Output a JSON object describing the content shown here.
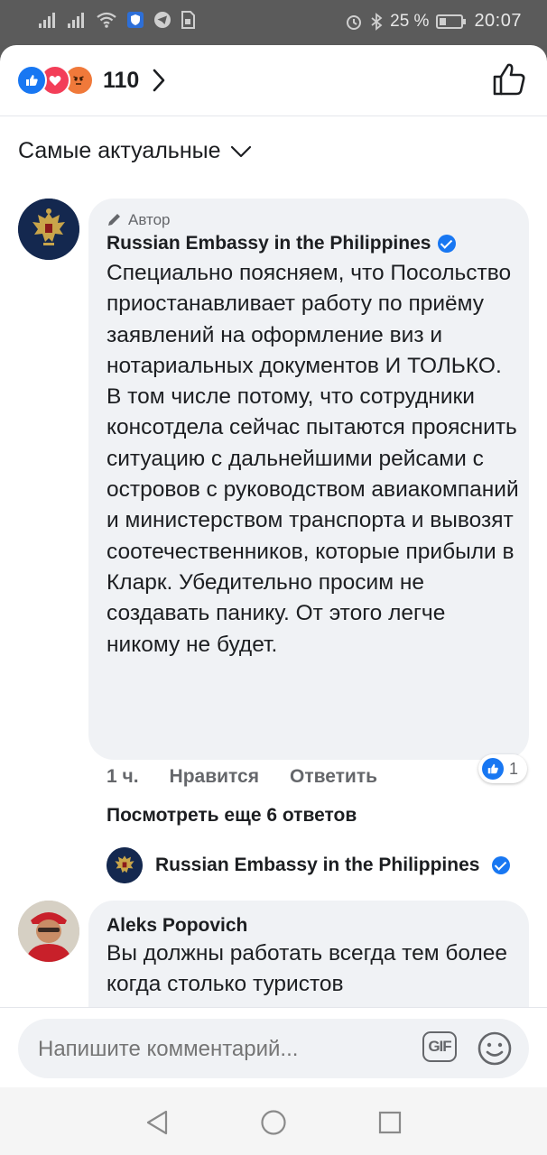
{
  "status_bar": {
    "battery_percent": "25 %",
    "time": "20:07"
  },
  "reactions": {
    "count": "110",
    "types": [
      "like",
      "love",
      "angry"
    ]
  },
  "sort": {
    "label": "Самые актуальные"
  },
  "comments": [
    {
      "author_tag": "Автор",
      "name": "Russian Embassy in the Philippines",
      "verified": true,
      "text": "Специально поясняем, что Посольство приостанавливает работу по приёму заявлений на оформление виз и нотариальных документов И ТОЛЬКО. В том числе потому, что сотрудники консотдела сейчас пытаются прояснить ситуацию с дальнейшими рейсами с островов с руководством авиакомпаний и министерством транспорта и вывозят соотечественников, которые прибыли в Кларк. Убедительно просим не создавать панику. От этого легче никому не будет.",
      "time": "1 ч.",
      "like_label": "Нравится",
      "reply_label": "Ответить",
      "like_count": "1",
      "more_replies": "Посмотреть еще 6 ответов",
      "reply_author": "Russian Embassy in the Philippines"
    },
    {
      "name": "Aleks Popovich",
      "text": "Вы должны работать всегда тем более когда столько туристов"
    }
  ],
  "compose": {
    "placeholder": "Напишите комментарий...",
    "gif_label": "GIF"
  },
  "colors": {
    "accent": "#1877f2",
    "bubble": "#f0f2f5",
    "secondary_text": "#65676b"
  }
}
